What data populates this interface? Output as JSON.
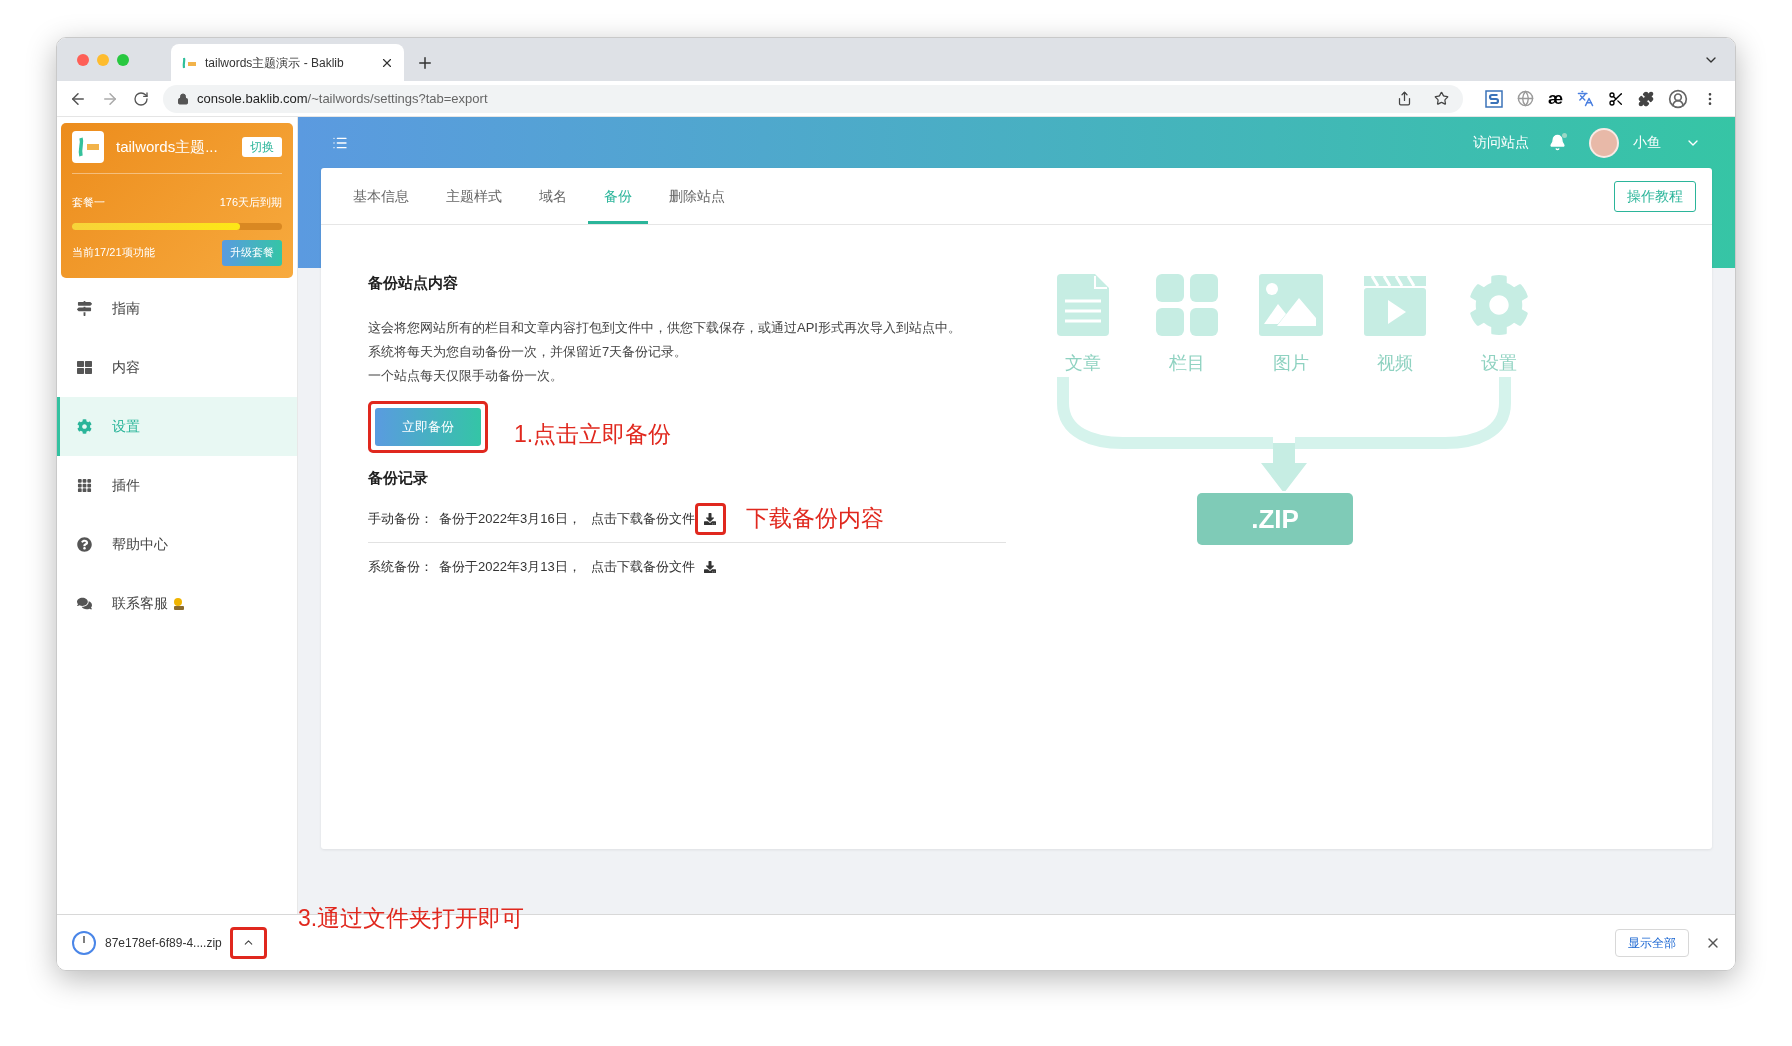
{
  "browser": {
    "tab_title": "tailwords主题演示 - Baklib",
    "url_host": "console.baklib.com",
    "url_path": "/~tailwords/settings?tab=export",
    "extensions": [
      {
        "kind": "s-logo"
      },
      {
        "kind": "globe"
      },
      {
        "kind": "glyph",
        "glyph": "æ"
      },
      {
        "kind": "translate"
      },
      {
        "kind": "scissors"
      },
      {
        "kind": "puzzle"
      }
    ]
  },
  "sidebar": {
    "site_name": "tailwords主题...",
    "switch_button": "切换",
    "plan": "套餐一",
    "expiry": "176天后到期",
    "level": 0.8,
    "features": "当前17/21项功能",
    "upgrade_button": "升级套餐",
    "items": [
      {
        "label": "指南",
        "kind": "signpost",
        "selected": false,
        "badge_icon": false
      },
      {
        "label": "内容",
        "kind": "grid",
        "selected": false,
        "badge_icon": false
      },
      {
        "label": "设置",
        "kind": "gear",
        "selected": true,
        "badge_icon": false
      },
      {
        "label": "插件",
        "kind": "dots",
        "selected": false,
        "badge_icon": false
      },
      {
        "label": "帮助中心",
        "kind": "help",
        "selected": false,
        "badge_icon": false
      },
      {
        "label": "联系客服",
        "kind": "chat",
        "selected": false,
        "badge_icon": true
      }
    ]
  },
  "header": {
    "visit_site": "访问站点",
    "user_name": "小鱼",
    "unread": true
  },
  "tabs": [
    {
      "label": "基本信息",
      "selected": false
    },
    {
      "label": "主题样式",
      "selected": false
    },
    {
      "label": "域名",
      "selected": false
    },
    {
      "label": "备份",
      "selected": true
    },
    {
      "label": "删除站点",
      "selected": false
    }
  ],
  "tutorial_button": "操作教程",
  "backup": {
    "title": "备份站点内容",
    "description": [
      "这会将您网站所有的栏目和文章内容打包到文件中，供您下载保存，或通过API形式再次导入到站点中。",
      "系统将每天为您自动备份一次，并保留近7天备份记录。",
      "一个站点每天仅限手动备份一次。"
    ],
    "button": "立即备份",
    "button_marked": true,
    "button_note": "1.点击立即备份",
    "records_title": "备份记录",
    "records": [
      {
        "label": "手动备份：",
        "date": "备份于2022年3月16日，",
        "action": "点击下载备份文件",
        "marked": true,
        "note": "下载备份内容"
      },
      {
        "label": "系统备份：",
        "date": "备份于2022年3月13日，",
        "action": "点击下载备份文件",
        "marked": false
      }
    ]
  },
  "illustration": {
    "items": [
      {
        "label": "文章",
        "kind": "document"
      },
      {
        "label": "栏目",
        "kind": "grid"
      },
      {
        "label": "图片",
        "kind": "image"
      },
      {
        "label": "视频",
        "kind": "video"
      },
      {
        "label": "设置",
        "kind": "gear"
      }
    ],
    "zip_label": ".ZIP"
  },
  "download_bar": {
    "file_name": "87e178ef-6f89-4....zip",
    "expand_marked": true,
    "note": "3.通过文件夹打开即可",
    "show_all": "显示全部"
  }
}
